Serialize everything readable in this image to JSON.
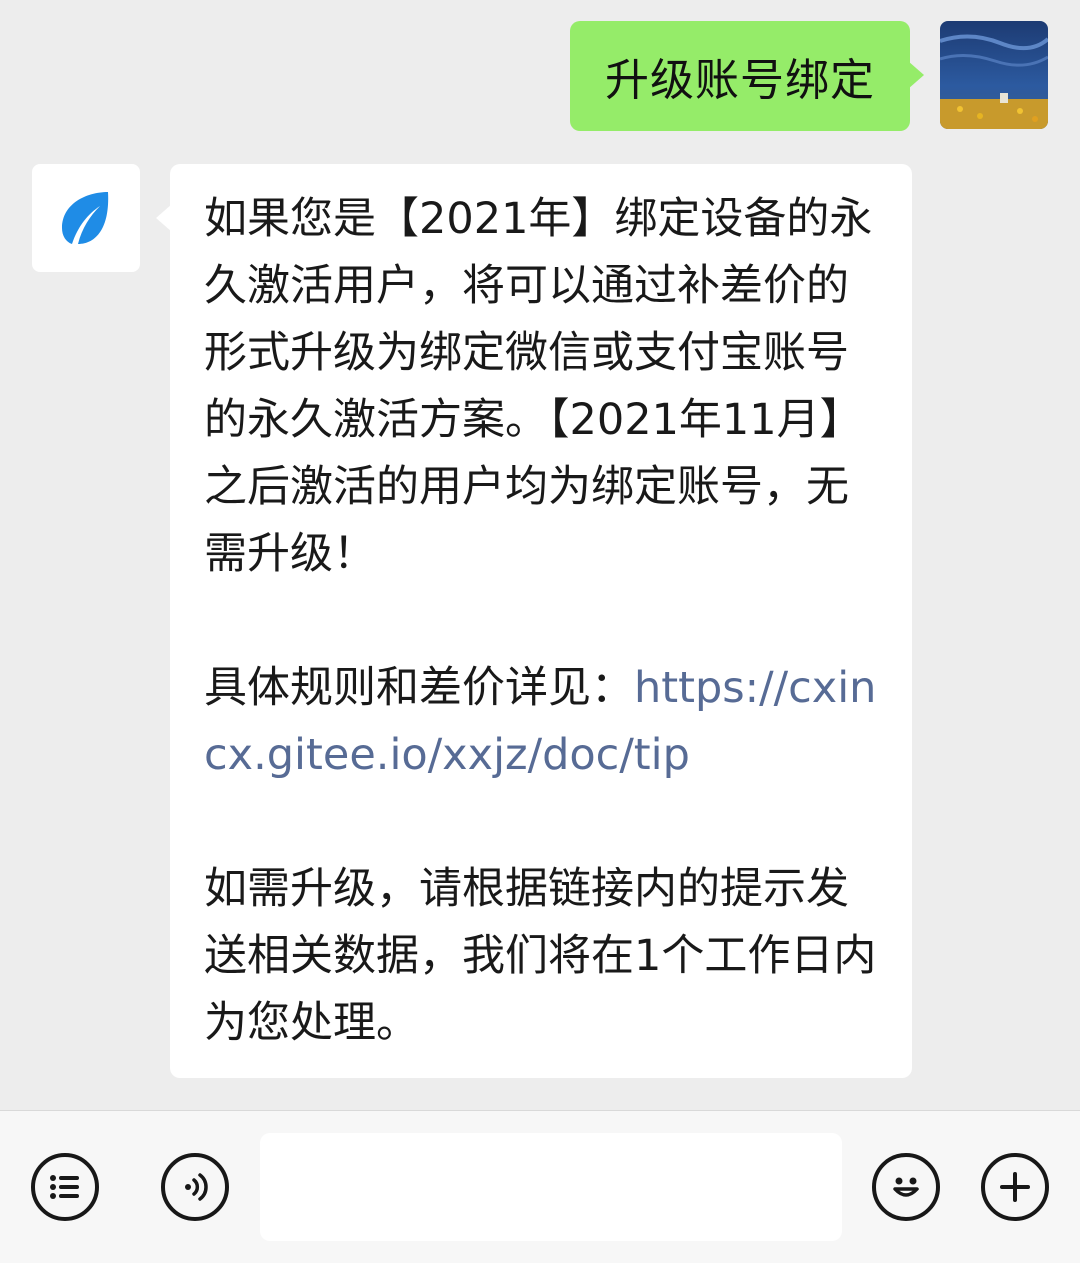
{
  "outgoing": {
    "text": "升级账号绑定"
  },
  "incoming": {
    "paragraphs": [
      "如果您是【2021年】绑定设备的永久激活用户，将可以通过补差价的形式升级为绑定微信或支付宝账号的永久激活方案。【2021年11月】之后激活的用户均为绑定账号，无需升级！",
      "",
      "",
      "如需升级，请根据链接内的提示发送相关数据，我们将在1个工作日内为您处理。"
    ],
    "link_prefix": "具体规则和差价详见：",
    "link_url": "https://cxincx.gitee.io/xxjz/doc/tip"
  },
  "input_bar": {
    "placeholder": "",
    "icons": [
      "menu-icon",
      "voice-icon",
      "emoji-icon",
      "plus-icon"
    ]
  },
  "colors": {
    "background": "#ededed",
    "outgoing_bubble": "#95ec69",
    "incoming_bubble": "#ffffff",
    "link": "#576b95",
    "brand_leaf": "#1f8ce6"
  }
}
